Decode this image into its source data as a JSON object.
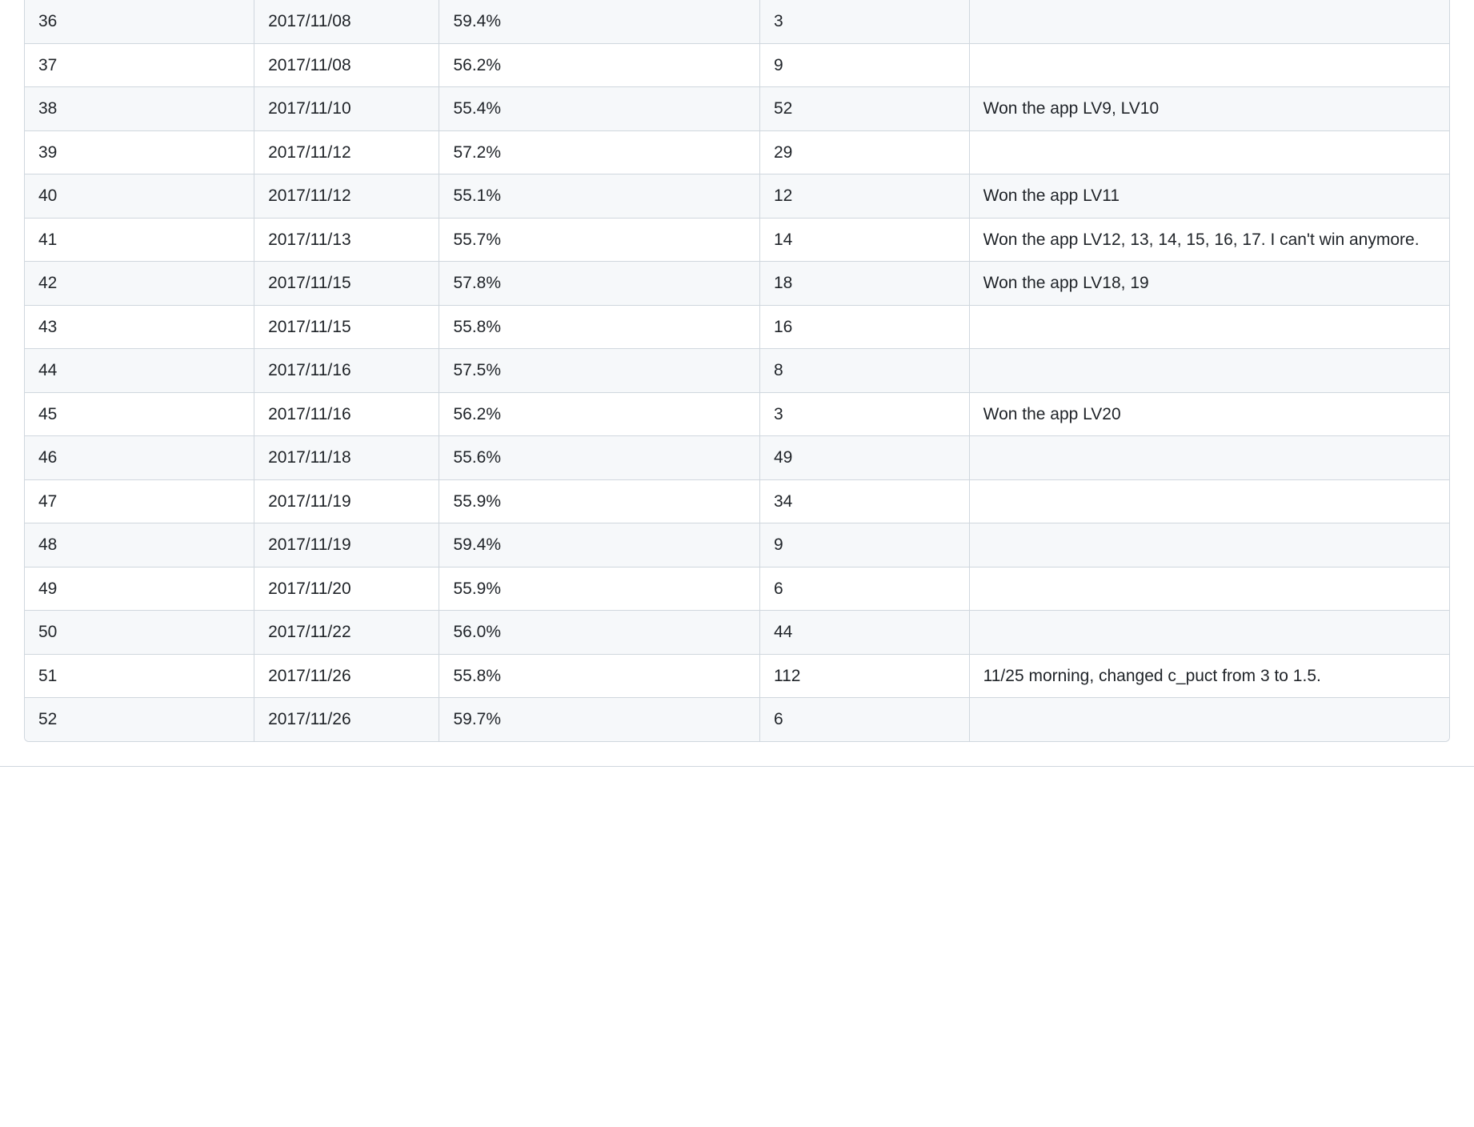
{
  "table": {
    "rows": [
      {
        "c1": "36",
        "c2": "2017/11/08",
        "c3": "59.4%",
        "c4": "3",
        "c5": ""
      },
      {
        "c1": "37",
        "c2": "2017/11/08",
        "c3": "56.2%",
        "c4": "9",
        "c5": ""
      },
      {
        "c1": "38",
        "c2": "2017/11/10",
        "c3": "55.4%",
        "c4": "52",
        "c5": "Won the app LV9, LV10"
      },
      {
        "c1": "39",
        "c2": "2017/11/12",
        "c3": "57.2%",
        "c4": "29",
        "c5": ""
      },
      {
        "c1": "40",
        "c2": "2017/11/12",
        "c3": "55.1%",
        "c4": "12",
        "c5": "Won the app LV11"
      },
      {
        "c1": "41",
        "c2": "2017/11/13",
        "c3": "55.7%",
        "c4": "14",
        "c5": "Won the app LV12, 13, 14, 15, 16, 17. I can't win anymore."
      },
      {
        "c1": "42",
        "c2": "2017/11/15",
        "c3": "57.8%",
        "c4": "18",
        "c5": "Won the app LV18, 19"
      },
      {
        "c1": "43",
        "c2": "2017/11/15",
        "c3": "55.8%",
        "c4": "16",
        "c5": ""
      },
      {
        "c1": "44",
        "c2": "2017/11/16",
        "c3": "57.5%",
        "c4": "8",
        "c5": ""
      },
      {
        "c1": "45",
        "c2": "2017/11/16",
        "c3": "56.2%",
        "c4": "3",
        "c5": "Won the app LV20"
      },
      {
        "c1": "46",
        "c2": "2017/11/18",
        "c3": "55.6%",
        "c4": "49",
        "c5": ""
      },
      {
        "c1": "47",
        "c2": "2017/11/19",
        "c3": "55.9%",
        "c4": "34",
        "c5": ""
      },
      {
        "c1": "48",
        "c2": "2017/11/19",
        "c3": "59.4%",
        "c4": "9",
        "c5": ""
      },
      {
        "c1": "49",
        "c2": "2017/11/20",
        "c3": "55.9%",
        "c4": "6",
        "c5": ""
      },
      {
        "c1": "50",
        "c2": "2017/11/22",
        "c3": "56.0%",
        "c4": "44",
        "c5": ""
      },
      {
        "c1": "51",
        "c2": "2017/11/26",
        "c3": "55.8%",
        "c4": "112",
        "c5": "11/25 morning, changed c_puct from 3 to 1.5."
      },
      {
        "c1": "52",
        "c2": "2017/11/26",
        "c3": "59.7%",
        "c4": "6",
        "c5": ""
      }
    ]
  }
}
